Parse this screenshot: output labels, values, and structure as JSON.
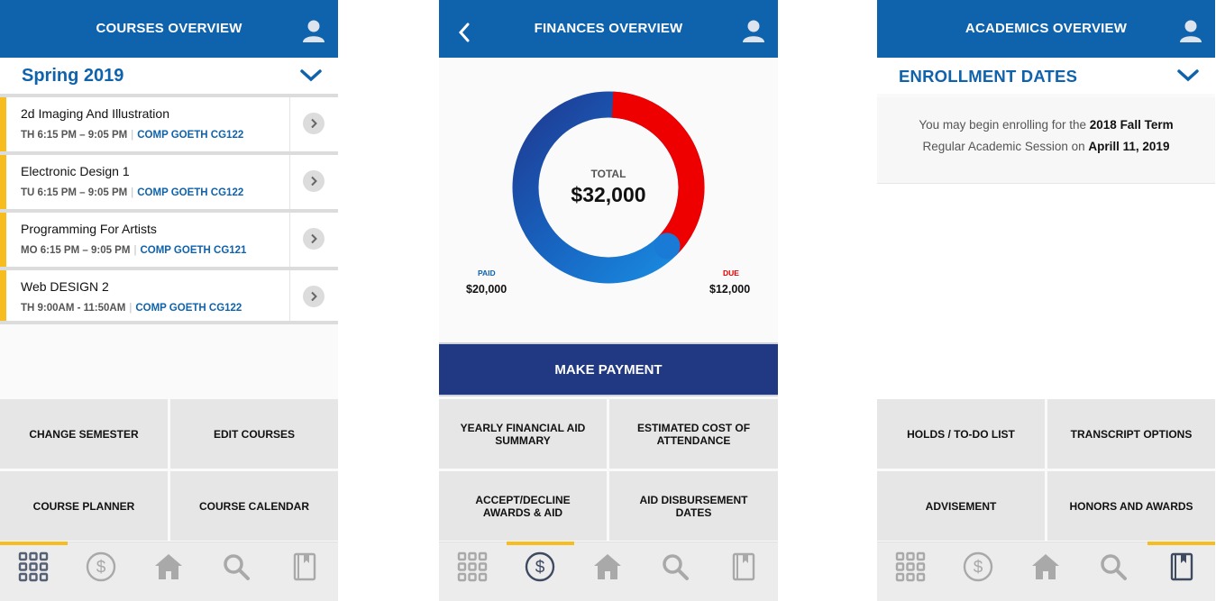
{
  "courses_screen": {
    "title": "COURSES OVERVIEW",
    "semester": "Spring 2019",
    "courses": [
      {
        "name": "2d Imaging And Illustration",
        "time": "TH 6:15 PM – 9:05 PM",
        "room": "COMP GOETH CG122"
      },
      {
        "name": "Electronic Design 1",
        "time": "TU 6:15 PM – 9:05 PM",
        "room": "COMP GOETH CG122"
      },
      {
        "name": "Programming For Artists",
        "time": "MO 6:15 PM – 9:05 PM",
        "room": "COMP GOETH CG121"
      },
      {
        "name": "Web DESIGN 2",
        "time": "TH 9:00AM - 11:50AM",
        "room": "COMP GOETH CG122"
      }
    ],
    "tiles": [
      "CHANGE SEMESTER",
      "EDIT COURSES",
      "COURSE PLANNER",
      "COURSE CALENDAR"
    ]
  },
  "finances_screen": {
    "title": "FINANCES OVERVIEW",
    "total_label": "TOTAL",
    "total_value": "$32,000",
    "paid_label": "PAID",
    "paid_value": "$20,000",
    "due_label": "DUE",
    "due_value": "$12,000",
    "paid_amount": 20000,
    "due_amount": 12000,
    "make_payment": "MAKE PAYMENT",
    "tiles": [
      "YEARLY FINANCIAL AID SUMMARY",
      "ESTIMATED COST OF ATTENDANCE",
      "ACCEPT/DECLINE AWARDS & AID",
      "AID DISBURSEMENT DATES"
    ]
  },
  "academics_screen": {
    "title": "ACADEMICS OVERVIEW",
    "section_label": "ENROLLMENT DATES",
    "message_prefix": "You may begin enrolling for the ",
    "message_term": "2018 Fall Term",
    "message_middle": "Regular Academic Session on ",
    "message_date": "Aprill 11, 2019",
    "tiles": [
      "HOLDS / TO-DO LIST",
      "TRANSCRIPT OPTIONS",
      "ADVISEMENT",
      "HONORS AND AWARDS"
    ]
  },
  "tabbar": {
    "tabs": [
      "grid-icon",
      "dollar-icon",
      "home-icon",
      "search-icon",
      "book-icon"
    ]
  },
  "colors": {
    "brand_blue": "#0f62ac",
    "navy": "#213883",
    "accent_yellow": "#f7bd1e",
    "due_red": "#e00000"
  }
}
